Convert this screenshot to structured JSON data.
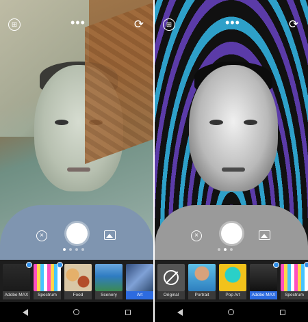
{
  "left": {
    "icons": {
      "grid": "grid-icon",
      "more": "more-icon",
      "flip": "flip-camera-icon",
      "close": "close-icon",
      "gallery": "gallery-icon"
    },
    "lenses": [
      {
        "label": "Adobe MAX",
        "selected": false,
        "badge": true
      },
      {
        "label": "Spectrum",
        "selected": false,
        "badge": true
      },
      {
        "label": "Food",
        "selected": false,
        "badge": false
      },
      {
        "label": "Scenery",
        "selected": false,
        "badge": false
      },
      {
        "label": "Art",
        "selected": true,
        "badge": false
      }
    ]
  },
  "right": {
    "icons": {
      "grid": "grid-icon",
      "more": "more-icon",
      "flip": "flip-camera-icon",
      "close": "close-icon",
      "gallery": "gallery-icon"
    },
    "lenses": [
      {
        "label": "Original",
        "selected": false,
        "badge": false
      },
      {
        "label": "Portrait",
        "selected": false,
        "badge": false
      },
      {
        "label": "Pop Art",
        "selected": false,
        "badge": false
      },
      {
        "label": "Adobe MAX",
        "selected": true,
        "badge": true
      },
      {
        "label": "Spectrum",
        "selected": false,
        "badge": true
      }
    ]
  },
  "glyphs": {
    "more": "•••",
    "flip": "⟳",
    "close": "×",
    "grid": "⊞"
  }
}
